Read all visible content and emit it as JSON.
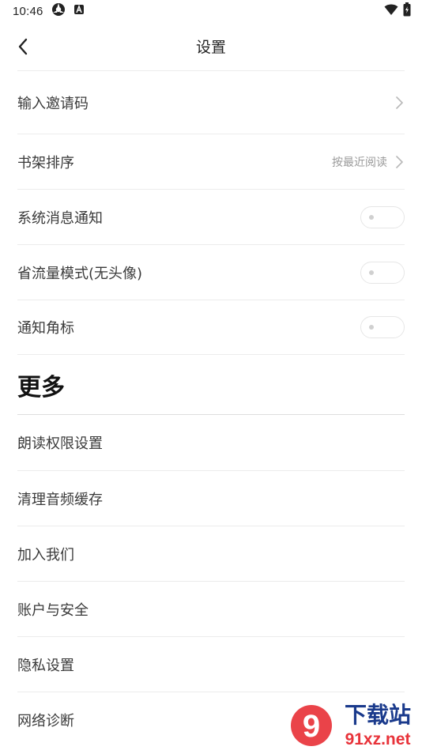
{
  "status_bar": {
    "time": "10:46",
    "icons": [
      "sync-icon",
      "a-badge-icon",
      "wifi-icon",
      "battery-icon"
    ]
  },
  "header": {
    "title": "设置",
    "back_icon": "chevron-left-icon"
  },
  "settings": {
    "invite_code": {
      "label": "输入邀请码"
    },
    "shelf_sort": {
      "label": "书架排序",
      "value": "按最近阅读"
    },
    "system_notify": {
      "label": "系统消息通知",
      "enabled": false
    },
    "data_saver": {
      "label": "省流量模式(无头像)",
      "enabled": false
    },
    "badge": {
      "label": "通知角标",
      "enabled": false
    }
  },
  "more": {
    "title": "更多",
    "items": [
      {
        "label": "朗读权限设置"
      },
      {
        "label": "清理音频缓存"
      },
      {
        "label": "加入我们"
      },
      {
        "label": "账户与安全"
      },
      {
        "label": "隐私设置"
      },
      {
        "label": "网络诊断"
      }
    ]
  },
  "watermark": {
    "logo_text": "9",
    "title": "下载站",
    "url": "91xz.net",
    "colors": {
      "red": "#e8333a",
      "blue": "#1a3a8c"
    }
  }
}
